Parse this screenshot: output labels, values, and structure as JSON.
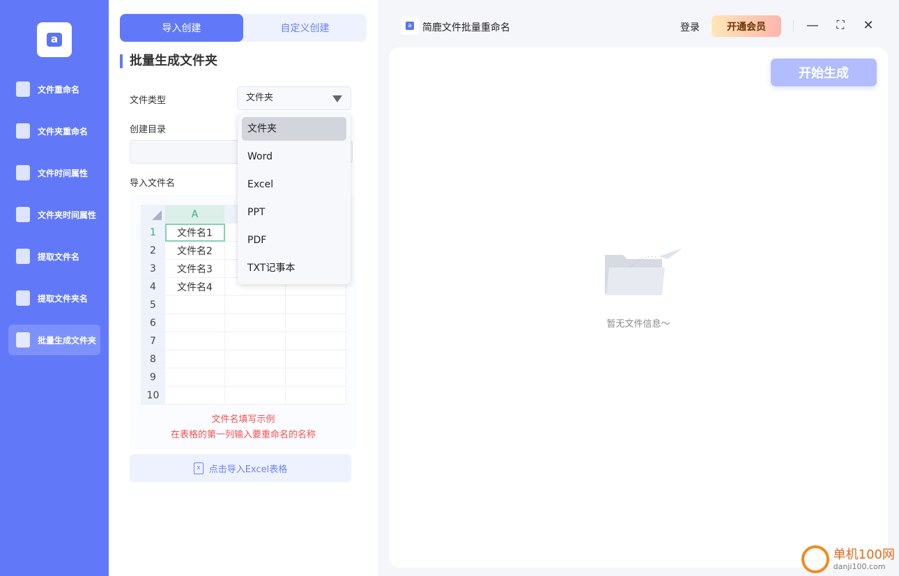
{
  "sidebar": {
    "items": [
      {
        "label": "文件重命名"
      },
      {
        "label": "文件夹重命名"
      },
      {
        "label": "文件时间属性"
      },
      {
        "label": "文件夹时间属性"
      },
      {
        "label": "提取文件名"
      },
      {
        "label": "提取文件夹名"
      },
      {
        "label": "批量生成文件夹",
        "active": true
      }
    ]
  },
  "tabs": [
    {
      "label": "导入创建",
      "active": true
    },
    {
      "label": "自定义创建"
    }
  ],
  "section_title": "批量生成文件夹",
  "form": {
    "file_type_label": "文件类型",
    "file_type_value": "文件夹",
    "create_dir_label": "创建目录",
    "create_dir_value": "",
    "import_names_label": "导入文件名"
  },
  "dropdown": {
    "options": [
      "文件夹",
      "Word",
      "Excel",
      "PPT",
      "PDF",
      "TXT记事本"
    ],
    "selected": "文件夹"
  },
  "sheet": {
    "col_header": "A",
    "rows": [
      "1",
      "2",
      "3",
      "4",
      "5",
      "6",
      "7",
      "8",
      "9",
      "10"
    ],
    "values": [
      "文件名1",
      "文件名2",
      "文件名3",
      "文件名4"
    ]
  },
  "hint": {
    "line1": "文件名填写示例",
    "line2": "在表格的第一列输入要重命名的名称"
  },
  "import_button": "点击导入Excel表格",
  "header": {
    "app_title": "简鹿文件批量重命名",
    "login": "登录",
    "vip": "开通会员",
    "minimize": "—",
    "maximize": "⛶",
    "close": "✕"
  },
  "main": {
    "start_button": "开始生成",
    "empty_text": "暂无文件信息～"
  },
  "watermark": {
    "line1": "单机100网",
    "line2": "danji100.com"
  },
  "colors": {
    "accent": "#6179f9",
    "hint": "#f25151"
  }
}
